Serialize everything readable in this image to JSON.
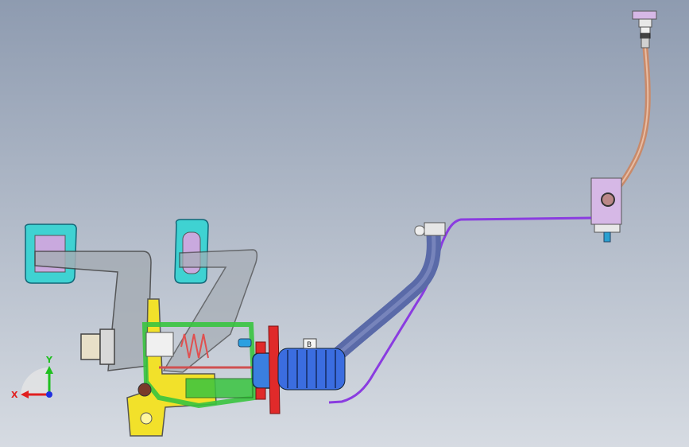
{
  "viewport": {
    "background_top": "#8e9bb0",
    "background_bottom": "#d6dbe2"
  },
  "triad": {
    "x_label": "X",
    "y_label": "Y",
    "x_color": "#e02020",
    "y_color": "#20c020",
    "z_color": "#2030e0"
  },
  "model": {
    "colors": {
      "pedal_pad": "#3fd2d2",
      "pedal_insert": "#c9a9de",
      "pedal_arm": "#a6adb5",
      "bracket": "#f2e12a",
      "frame": "#39c43f",
      "cylinder": "#3a7fe0",
      "flange": "#e02a2a",
      "boot": "#3b6de0",
      "hose": "#5a6aa8",
      "purple_line": "#8a3ce0",
      "copper_pipe": "#c98a6a",
      "top_fitting": "#d6b8e6"
    },
    "callout_text": "B"
  }
}
